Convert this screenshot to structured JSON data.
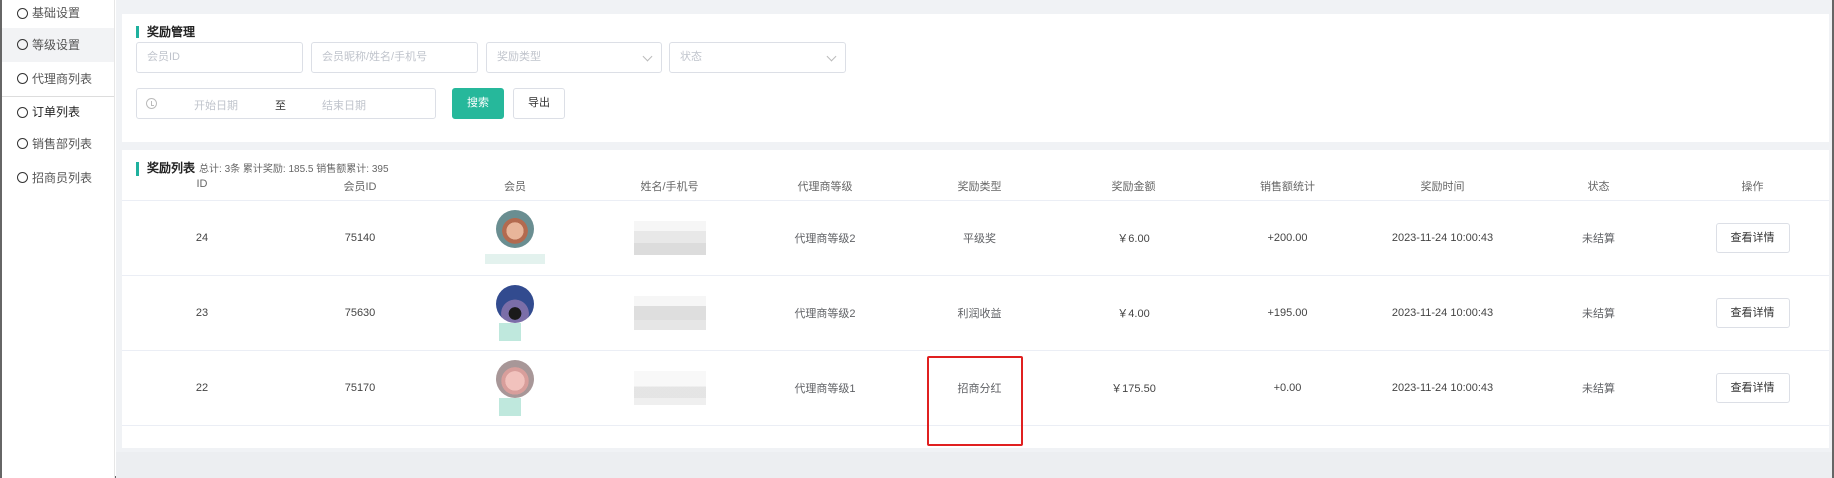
{
  "sidebar": {
    "items": [
      {
        "label": "基础设置"
      },
      {
        "label": "等级设置"
      },
      {
        "label": "代理商列表"
      },
      {
        "label": "订单列表"
      },
      {
        "label": "销售部列表"
      },
      {
        "label": "招商员列表"
      }
    ]
  },
  "filter": {
    "title": "奖励管理",
    "member_id_placeholder": "会员ID",
    "member_name_placeholder": "会员昵称/姓名/手机号",
    "reward_type_placeholder": "奖励类型",
    "status_placeholder": "状态",
    "start_date_placeholder": "开始日期",
    "range_separator": "至",
    "end_date_placeholder": "结束日期",
    "search_label": "搜索",
    "export_label": "导出"
  },
  "list": {
    "title": "奖励列表",
    "summary": "总计: 3条 累计奖励: 185.5 销售额累计: 395",
    "columns": [
      "ID",
      "会员ID",
      "会员",
      "姓名/手机号",
      "代理商等级",
      "奖励类型",
      "奖励金额",
      "销售额统计",
      "奖励时间",
      "状态",
      "操作"
    ],
    "rows": [
      {
        "id": "24",
        "member_id": "75140",
        "level": "代理商等级2",
        "reward_type": "平级奖",
        "amount": "￥6.00",
        "sales": "+200.00",
        "time": "2023-11-24 10:00:43",
        "status": "未结算",
        "action": "查看详情"
      },
      {
        "id": "23",
        "member_id": "75630",
        "level": "代理商等级2",
        "reward_type": "利润收益",
        "amount": "￥4.00",
        "sales": "+195.00",
        "time": "2023-11-24 10:00:43",
        "status": "未结算",
        "action": "查看详情"
      },
      {
        "id": "22",
        "member_id": "75170",
        "level": "代理商等级1",
        "reward_type": "招商分红",
        "amount": "￥175.50",
        "sales": "+0.00",
        "time": "2023-11-24 10:00:43",
        "status": "未结算",
        "action": "查看详情"
      }
    ]
  },
  "colors": {
    "accent": "#26b89b",
    "highlight_box": "#e02020"
  }
}
